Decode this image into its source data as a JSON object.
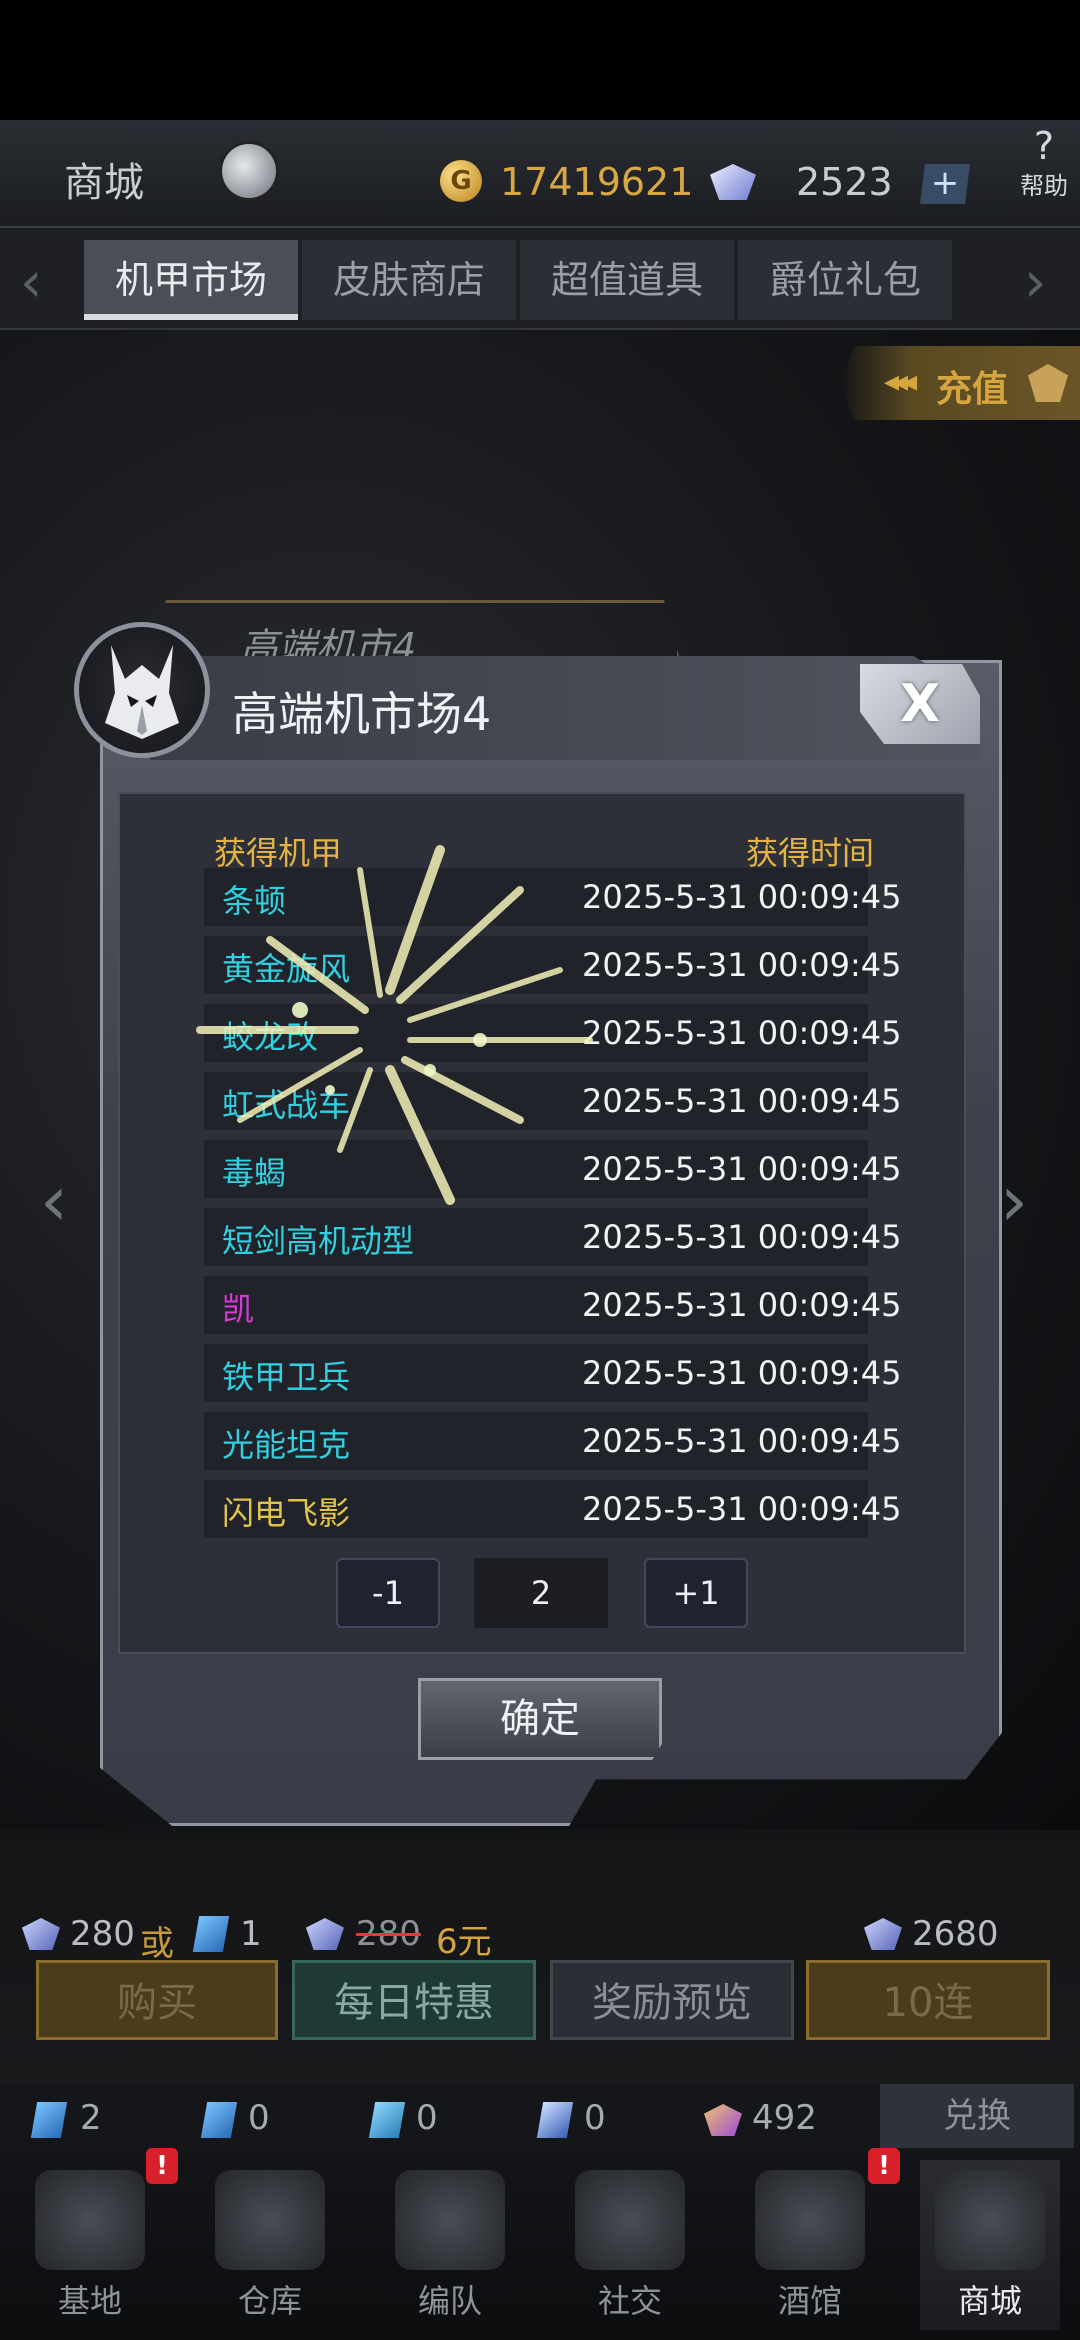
{
  "header": {
    "title": "商城",
    "coins": "17419621",
    "gems": "2523",
    "plus_label": "+",
    "help_label": "帮助",
    "help_glyph": "?"
  },
  "tabs": [
    {
      "label": "机甲市场"
    },
    {
      "label": "皮肤商店"
    },
    {
      "label": "超值道具"
    },
    {
      "label": "爵位礼包"
    }
  ],
  "recharge": {
    "label": "充值",
    "arrows": "◂◂◂"
  },
  "background_card_title": "高端机市4",
  "modal": {
    "title": "高端机市场4",
    "close_label": "X",
    "col_mech": "获得机甲",
    "col_time": "获得时间",
    "rows": [
      {
        "name": "条顿",
        "time": "2025-5-31 00:09:45",
        "rarity": "cyan"
      },
      {
        "name": "黄金旋风",
        "time": "2025-5-31 00:09:45",
        "rarity": "cyan"
      },
      {
        "name": "蛟龙改",
        "time": "2025-5-31 00:09:45",
        "rarity": "cyan"
      },
      {
        "name": "虹式战车",
        "time": "2025-5-31 00:09:45",
        "rarity": "cyan"
      },
      {
        "name": "毒蝎",
        "time": "2025-5-31 00:09:45",
        "rarity": "cyan"
      },
      {
        "name": "短剑高机动型",
        "time": "2025-5-31 00:09:45",
        "rarity": "cyan"
      },
      {
        "name": "凯",
        "time": "2025-5-31 00:09:45",
        "rarity": "purple"
      },
      {
        "name": "铁甲卫兵",
        "time": "2025-5-31 00:09:45",
        "rarity": "cyan"
      },
      {
        "name": "光能坦克",
        "time": "2025-5-31 00:09:45",
        "rarity": "cyan"
      },
      {
        "name": "闪电飞影",
        "time": "2025-5-31 00:09:45",
        "rarity": "yellow"
      }
    ],
    "pager": {
      "minus": "-1",
      "page": "2",
      "plus": "+1"
    },
    "confirm_label": "确定"
  },
  "price_info": {
    "cost_gems": "280",
    "or": "或",
    "cost_tickets": "1",
    "original_price": "280",
    "sale_price": "6元",
    "ten_cost": "2680"
  },
  "actions": {
    "buy": "购买",
    "daily": "每日特惠",
    "preview": "奖励预览",
    "ten": "10连"
  },
  "resources": {
    "r1": "2",
    "r2": "0",
    "r3": "0",
    "r4": "0",
    "r5": "492",
    "exchange": "兑换"
  },
  "nav": [
    {
      "label": "基地"
    },
    {
      "label": "仓库"
    },
    {
      "label": "编队"
    },
    {
      "label": "社交"
    },
    {
      "label": "酒馆"
    },
    {
      "label": "商城"
    }
  ],
  "badges": {
    "b1": "!",
    "b2": "!"
  },
  "colors": {
    "accent_gold": "#d6a53f",
    "mech_cyan": "#31d0e0",
    "mech_purple": "#d83ad8",
    "mech_yellow": "#e0c34a"
  }
}
